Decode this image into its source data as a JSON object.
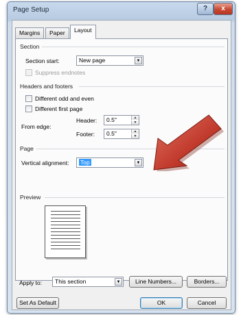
{
  "window": {
    "title": "Page Setup",
    "help_label": "?",
    "close_label": "x"
  },
  "tabs": [
    {
      "label": "Margins",
      "active": false
    },
    {
      "label": "Paper",
      "active": false
    },
    {
      "label": "Layout",
      "active": true
    }
  ],
  "section": {
    "heading": "Section",
    "start_label": "Section start:",
    "start_value": "New page",
    "suppress_label": "Suppress endnotes"
  },
  "headers_footers": {
    "heading": "Headers and footers",
    "odd_even_label": "Different odd and even",
    "first_page_label": "Different first page",
    "from_edge_label": "From edge:",
    "header_label": "Header:",
    "header_value": "0.5\"",
    "footer_label": "Footer:",
    "footer_value": "0.5\""
  },
  "page": {
    "heading": "Page",
    "vertical_alignment_label": "Vertical alignment:",
    "vertical_alignment_value": "Top"
  },
  "preview": {
    "heading": "Preview"
  },
  "bottom": {
    "apply_to_label": "Apply to:",
    "apply_to_value": "This section",
    "line_numbers_label": "Line Numbers...",
    "borders_label": "Borders..."
  },
  "footer_buttons": {
    "set_default_label": "Set As Default",
    "ok_label": "OK",
    "cancel_label": "Cancel"
  },
  "colors": {
    "arrow": "#c0392b",
    "selection": "#3399ff"
  },
  "icons": {
    "combo_arrow": "▼",
    "spin_up": "▲",
    "spin_down": "▼"
  }
}
